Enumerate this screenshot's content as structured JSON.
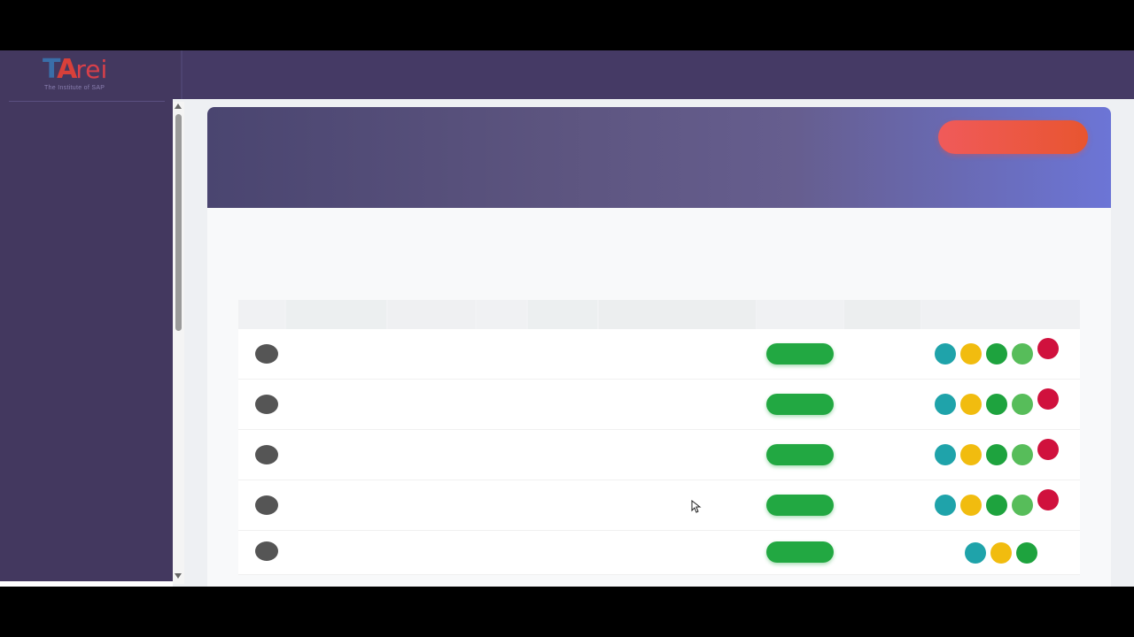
{
  "brand": {
    "logo_mark_t": "T",
    "logo_mark_a": "A",
    "logo_mark_rei": "rei",
    "tagline": "The Institute of SAP"
  },
  "header": {
    "action_button_label": ""
  },
  "colors": {
    "topbar": "#453a65",
    "sidebar": "#43385f",
    "header_gradient_start": "#4a4570",
    "header_gradient_end": "#6c75d6",
    "header_button": "#f05a5a",
    "status_active": "#22a842",
    "action_view": "#1fa3aa",
    "action_edit": "#f1bc0f",
    "action_approve": "#1ea33e",
    "action_enable": "#57bd5a",
    "action_delete": "#d0113d"
  },
  "table": {
    "rows": [
      {
        "status": "active",
        "actions": [
          "view-icon",
          "edit-icon",
          "approve-icon",
          "enable-icon",
          "delete-icon"
        ]
      },
      {
        "status": "active",
        "actions": [
          "view-icon",
          "edit-icon",
          "approve-icon",
          "enable-icon",
          "delete-icon"
        ]
      },
      {
        "status": "active",
        "actions": [
          "view-icon",
          "edit-icon",
          "approve-icon",
          "enable-icon",
          "delete-icon"
        ]
      },
      {
        "status": "active",
        "actions": [
          "view-icon",
          "edit-icon",
          "approve-icon",
          "enable-icon",
          "delete-icon"
        ]
      },
      {
        "status": "active",
        "actions": [
          "view-icon",
          "edit-icon",
          "approve-icon"
        ]
      }
    ]
  }
}
